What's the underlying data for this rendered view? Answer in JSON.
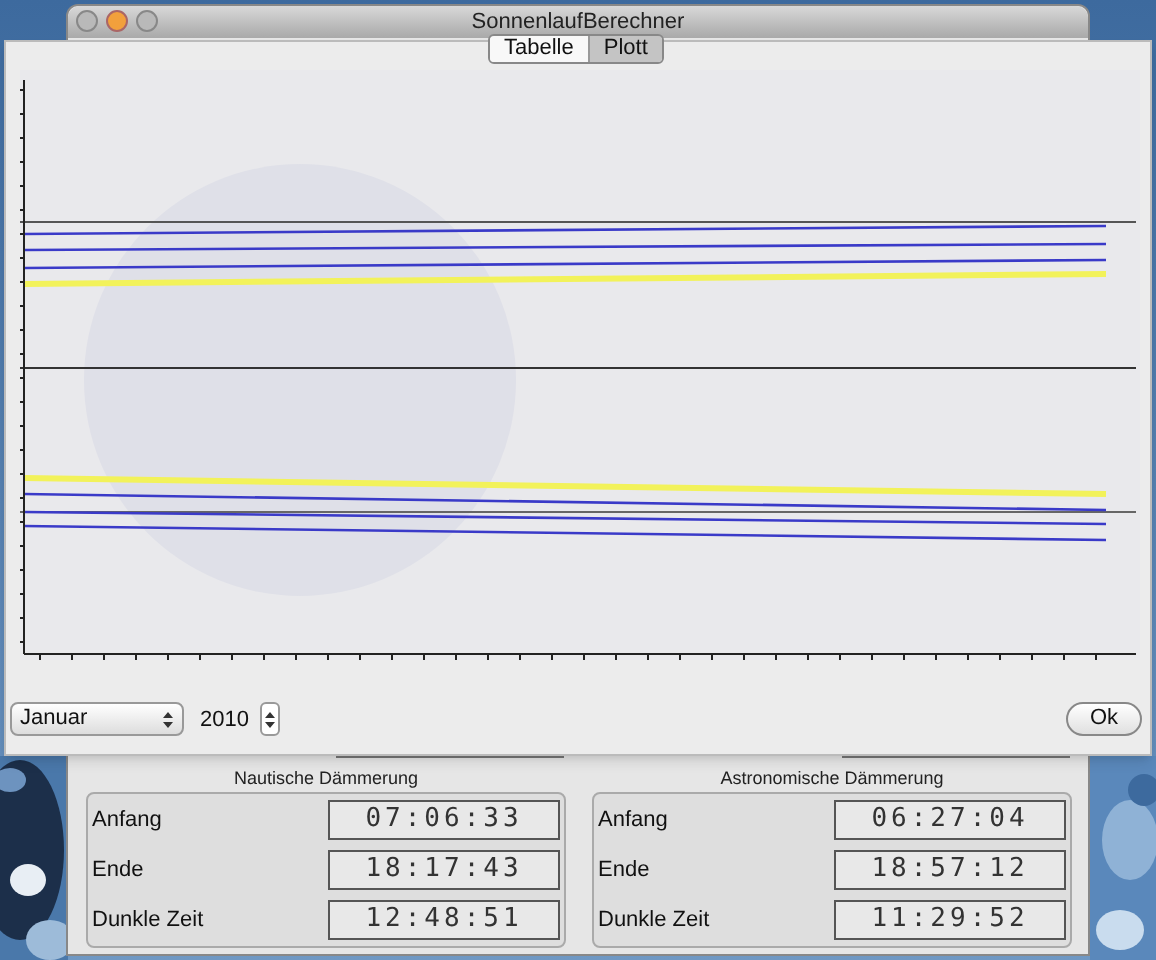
{
  "window": {
    "title": "SonnenlaufBerechner"
  },
  "tabs": [
    {
      "label": "Tabelle",
      "selected": false
    },
    {
      "label": "Plott",
      "selected": true
    }
  ],
  "month_select": {
    "value": "Januar"
  },
  "year_field": {
    "value": "2010"
  },
  "ok_button": {
    "label": "Ok"
  },
  "sections": [
    {
      "title": "Nautische Dämmerung",
      "rows": [
        {
          "label": "Anfang",
          "time": "07:06:33"
        },
        {
          "label": "Ende",
          "time": "18:17:43"
        },
        {
          "label": "Dunkle Zeit",
          "time": "12:48:51"
        }
      ]
    },
    {
      "title": "Astronomische Dämmerung",
      "rows": [
        {
          "label": "Anfang",
          "time": "06:27:04"
        },
        {
          "label": "Ende",
          "time": "18:57:12"
        },
        {
          "label": "Dunkle Zeit",
          "time": "11:29:52"
        }
      ]
    }
  ]
}
